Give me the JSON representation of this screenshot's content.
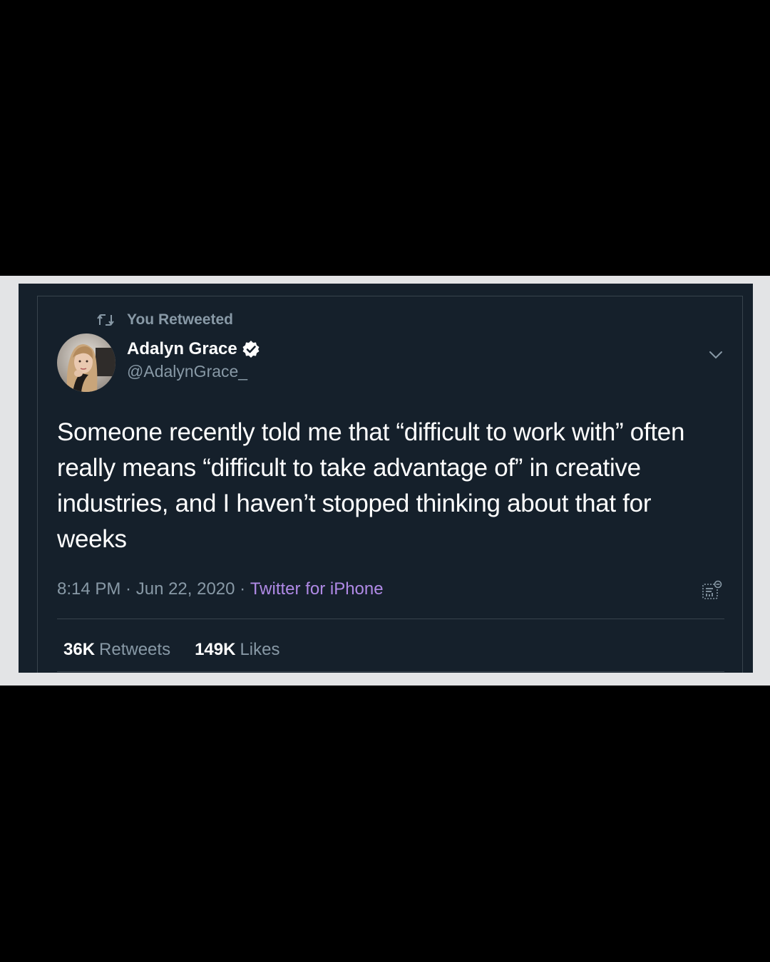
{
  "retweet": {
    "label": "You Retweeted",
    "icon": "retweet-icon"
  },
  "author": {
    "name": "Adalyn Grace",
    "handle": "@AdalynGrace_",
    "verified": true,
    "avatar": "profile-photo"
  },
  "tweet": {
    "text": "Someone recently told me that “difficult to work with” often really means “difficult to take advantage of” in creative industries, and I haven’t stopped thinking about that for weeks",
    "time": "8:14 PM",
    "date": "Jun 22, 2020",
    "source": "Twitter for iPhone"
  },
  "stats": {
    "retweets_count": "36K",
    "retweets_label": "Retweets",
    "likes_count": "149K",
    "likes_label": "Likes"
  },
  "colors": {
    "background": "#15202b",
    "secondary_text": "#8899a6",
    "source_link": "#b08ae6",
    "border": "#38444d"
  }
}
